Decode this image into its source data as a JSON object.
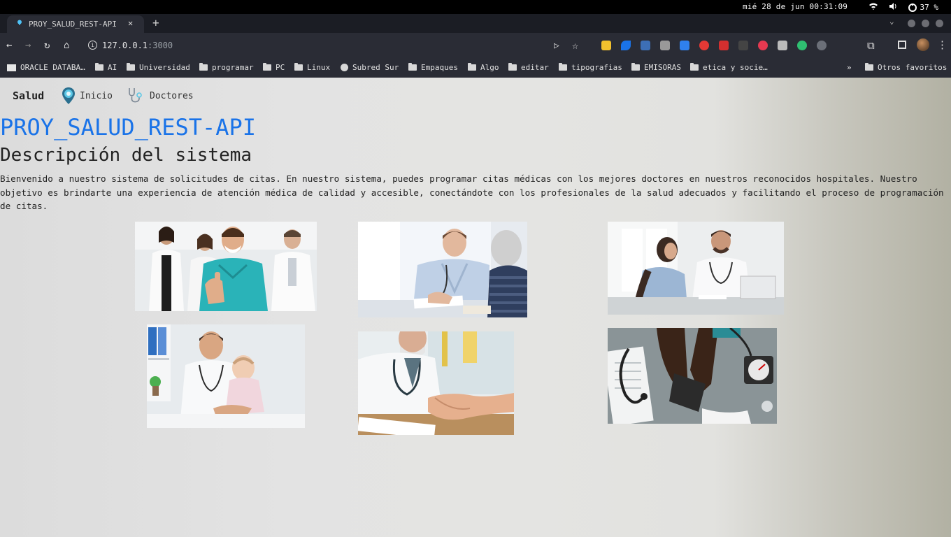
{
  "os": {
    "clock": "mié 28 de jun 00:31:09",
    "battery": "37 %"
  },
  "browser": {
    "tab_title": "PROY_SALUD_REST-API",
    "url_host": "127.0.0.1",
    "url_port": ":3000",
    "bookmarks": [
      {
        "label": "ORACLE DATABA…",
        "icon": "oracle-icon"
      },
      {
        "label": "AI",
        "icon": "folder-icon"
      },
      {
        "label": "Universidad",
        "icon": "folder-icon"
      },
      {
        "label": "programar",
        "icon": "folder-icon"
      },
      {
        "label": "PC",
        "icon": "folder-icon"
      },
      {
        "label": "Linux",
        "icon": "folder-icon"
      },
      {
        "label": "Subred Sur",
        "icon": "globe-icon"
      },
      {
        "label": "Empaques",
        "icon": "folder-icon"
      },
      {
        "label": "Algo",
        "icon": "folder-icon"
      },
      {
        "label": "editar",
        "icon": "folder-icon"
      },
      {
        "label": "tipografias",
        "icon": "folder-icon"
      },
      {
        "label": "EMISORAS",
        "icon": "folder-icon"
      },
      {
        "label": "etica y socie…",
        "icon": "folder-icon"
      }
    ],
    "overflow": "»",
    "other_bookmarks": "Otros favoritos"
  },
  "page": {
    "brand": "Salud",
    "nav": [
      {
        "label": "Inicio",
        "icon": "location-pin-icon"
      },
      {
        "label": "Doctores",
        "icon": "stethoscope-icon"
      }
    ],
    "title": "PROY_SALUD_REST-API",
    "section_title": "Descripción del sistema",
    "intro": "Bienvenido a nuestro sistema de solicitudes de citas. En nuestro sistema, puedes programar citas médicas con los mejores doctores en nuestros reconocidos hospitales. Nuestro objetivo es brindarte una experiencia de atención médica de calidad y accesible, conectándote con los profesionales de la salud adecuados y facilitando el proceso de programación de citas.",
    "photos": [
      "doctors-team-photo",
      "doctor-writing-with-patient-photo",
      "doctor-consulting-patient-photo",
      "pediatrician-with-baby-photo",
      "doctor-handshake-photo",
      "blood-pressure-measurement-photo"
    ]
  }
}
